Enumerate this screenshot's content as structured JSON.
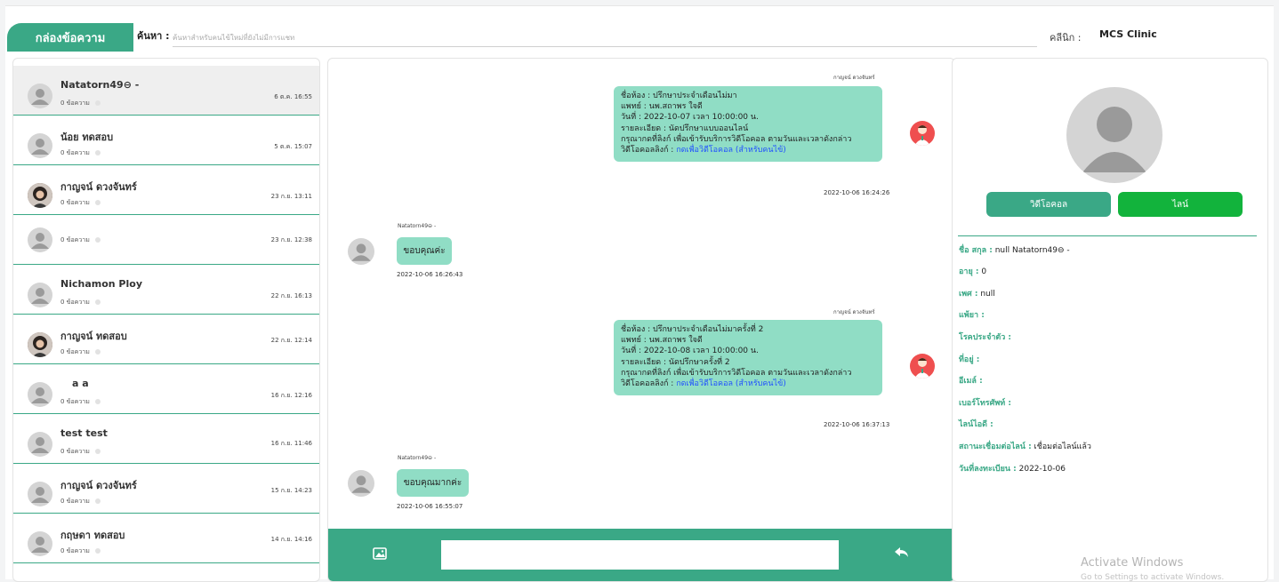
{
  "header": {
    "title": "กล่องข้อความ",
    "search_label": "ค้นหา :",
    "search_placeholder": "ค้นหาสำหรับคนไข้ใหม่ที่ยังไม่มีการแชท",
    "clinic_label": "คลีนิก :",
    "clinic_name": "MCS Clinic"
  },
  "conversations": [
    {
      "name": "Natatorn49⊖ -",
      "msgs": "0 ข้อความ",
      "time": "6 ต.ค. 16:55",
      "photo": false,
      "active": true
    },
    {
      "name": "น้อย ทดสอบ",
      "msgs": "0 ข้อความ",
      "time": "5 ต.ค. 15:07",
      "photo": false
    },
    {
      "name": "กาญจน์ ดวงจันทร์",
      "msgs": "0 ข้อความ",
      "time": "23 ก.ย. 13:11",
      "photo": true
    },
    {
      "name": "",
      "msgs": "0 ข้อความ",
      "time": "23 ก.ย. 12:38",
      "photo": false
    },
    {
      "name": "Nichamon Ploy",
      "msgs": "0 ข้อความ",
      "time": "22 ก.ย. 16:13",
      "photo": false
    },
    {
      "name": "กาญจน์ ทดสอบ",
      "msgs": "0 ข้อความ",
      "time": "22 ก.ย. 12:14",
      "photo": true
    },
    {
      "name": "a a",
      "msgs": "0 ข้อความ",
      "time": "16 ก.ย. 12:16",
      "photo": false
    },
    {
      "name": "test test",
      "msgs": "0 ข้อความ",
      "time": "16 ก.ย. 11:46",
      "photo": false
    },
    {
      "name": "กาญจน์ ดวงจันทร์",
      "msgs": "0 ข้อความ",
      "time": "15 ก.ย. 14:23",
      "photo": false
    },
    {
      "name": "กฤษดา ทดสอบ",
      "msgs": "0 ข้อความ",
      "time": "14 ก.ย. 14:16",
      "photo": false
    }
  ],
  "chat": {
    "doctor_sender": "กาญจน์ ดวงจันทร์",
    "patient_sender": "Natatorn49⊖ -",
    "msg1": {
      "lines": [
        "ชื่อห้อง : ปรึกษาประจำเดือนไม่มา",
        "แพทย์ : นพ.สถาพร ใจดี",
        "วันที่ : 2022-10-07 เวลา 10:00:00 น.",
        "รายละเอียด : นัดปรึกษาแบบออนไลน์",
        "กรุณากดที่ลิงก์ เพื่อเข้ารับบริการวิดีโอคอล ตามวันและเวลาดังกล่าว"
      ],
      "link_prefix": "วิดีโอคอลลิงก์ : ",
      "link_text": "กดเพื่อวิดีโอคอล (สำหรับคนไข้)",
      "timestamp": "2022-10-06 16:24:26"
    },
    "reply1": {
      "text": "ขอบคุณค่ะ",
      "timestamp": "2022-10-06 16:26:43"
    },
    "msg2": {
      "lines": [
        "ชื่อห้อง : ปรึกษาประจำเดือนไม่มาครั้งที่ 2",
        "แพทย์ : นพ.สถาพร ใจดี",
        "วันที่ : 2022-10-08 เวลา 10:00:00 น.",
        "รายละเอียด : นัดปรึกษาครั้งที่ 2",
        "กรุณากดที่ลิงก์ เพื่อเข้ารับบริการวิดีโอคอล ตามวันและเวลาดังกล่าว"
      ],
      "link_prefix": "วิดีโอคอลลิงก์ : ",
      "link_text": "กดเพื่อวิดีโอคอล (สำหรับคนไข้)",
      "timestamp": "2022-10-06 16:37:13"
    },
    "reply2": {
      "text": "ขอบคุณมากค่ะ",
      "timestamp": "2022-10-06 16:55:07"
    },
    "composer": {
      "image_icon": "image-icon",
      "send_icon": "reply-arrow-icon"
    }
  },
  "profile": {
    "video_button": "วิดีโอคอล",
    "line_button": "ไลน์",
    "fields": [
      {
        "label": "ชื่อ สกุล :",
        "value": " null Natatorn49⊖ -"
      },
      {
        "label": "อายุ :",
        "value": " 0"
      },
      {
        "label": "เพศ :",
        "value": " null"
      },
      {
        "label": "แพ้ยา :",
        "value": ""
      },
      {
        "label": "โรคประจำตัว :",
        "value": ""
      },
      {
        "label": "ที่อยู่ :",
        "value": ""
      },
      {
        "label": "อีเมล์ :",
        "value": ""
      },
      {
        "label": "เบอร์โทรศัพท์ :",
        "value": ""
      },
      {
        "label": "ไลน์ไอดี :",
        "value": ""
      },
      {
        "label": "สถานะเชื่อมต่อไลน์ :",
        "value": " เชื่อมต่อไลน์แล้ว"
      },
      {
        "label": "วันที่ลงทะเบียน :",
        "value": " 2022-10-06"
      }
    ]
  },
  "watermark": {
    "line1": "Activate Windows",
    "line2": "Go to Settings to activate Windows."
  },
  "colors": {
    "accent": "#3aa886",
    "bubble": "#90ddc5",
    "line_green": "#12b33c",
    "doctor_red": "#ef4f4f",
    "link_blue": "#2050ff"
  }
}
